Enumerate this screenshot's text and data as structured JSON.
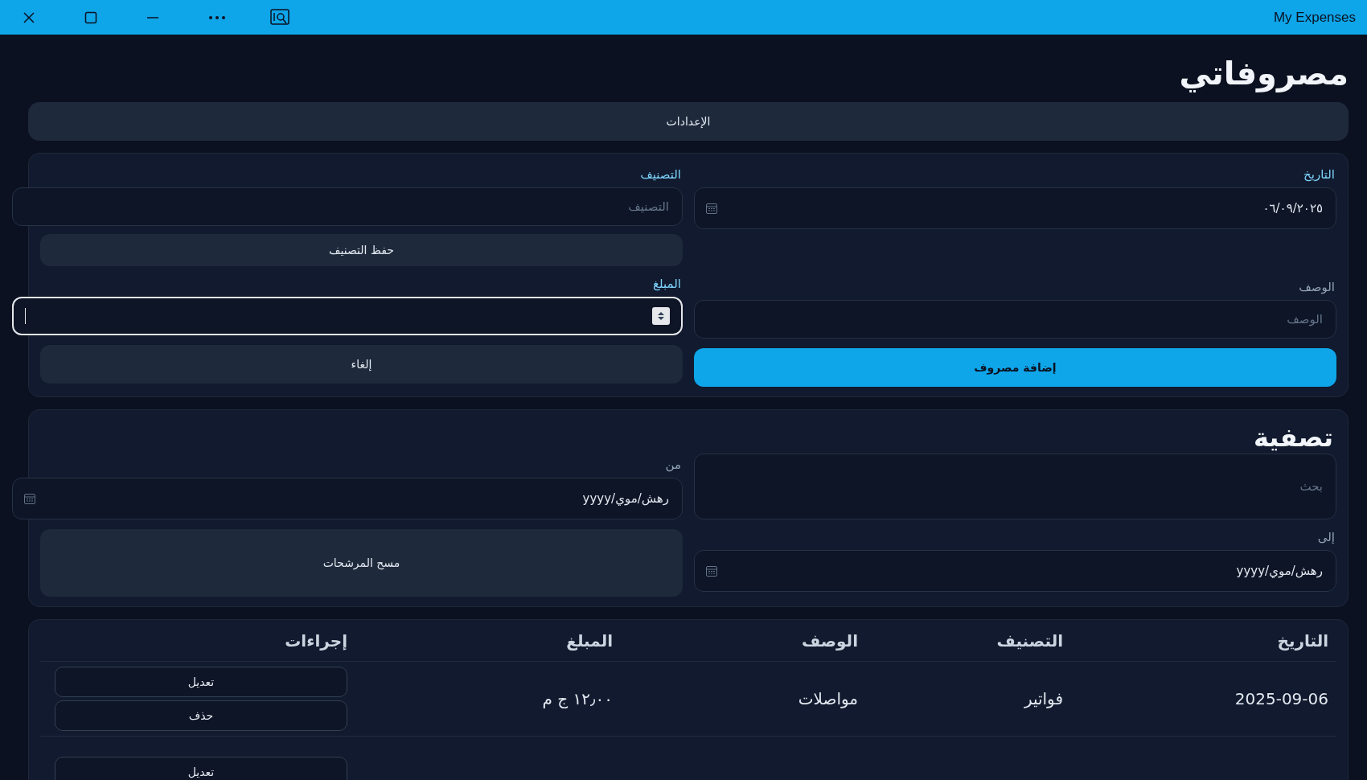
{
  "window": {
    "title": "My Expenses"
  },
  "app_title": "مصروفاتي",
  "settings_button": "الإعدادات",
  "expense_form": {
    "date": {
      "label": "التاريخ",
      "value": "٠٦/٠٩/٢٠٢٥"
    },
    "category": {
      "label": "التصنيف",
      "placeholder": "التصنيف"
    },
    "save_category_button": "حفظ التصنيف",
    "description": {
      "label": "الوصف",
      "placeholder": "الوصف"
    },
    "amount": {
      "label": "المبلغ",
      "focused": true
    },
    "add_button": "إضافة مصروف",
    "cancel_button": "إلغاء"
  },
  "filter": {
    "title": "تصفية",
    "search": {
      "placeholder": "بحث"
    },
    "from": {
      "label": "من",
      "placeholder": "yyyy/رهش/موي"
    },
    "to": {
      "label": "إلى",
      "placeholder": "yyyy/رهش/موي"
    },
    "clear_button": "مسح المرشحات"
  },
  "table": {
    "columns": [
      "التاريخ",
      "التصنيف",
      "الوصف",
      "المبلغ",
      "إجراءات"
    ],
    "rows": [
      {
        "date": "2025-09-06",
        "category": "فواتير",
        "description": "مواصلات",
        "amount": "١٢٫٠٠ ج م",
        "actions": [
          "تعديل",
          "حذف"
        ]
      },
      {
        "actions": [
          "تعديل"
        ]
      }
    ]
  }
}
